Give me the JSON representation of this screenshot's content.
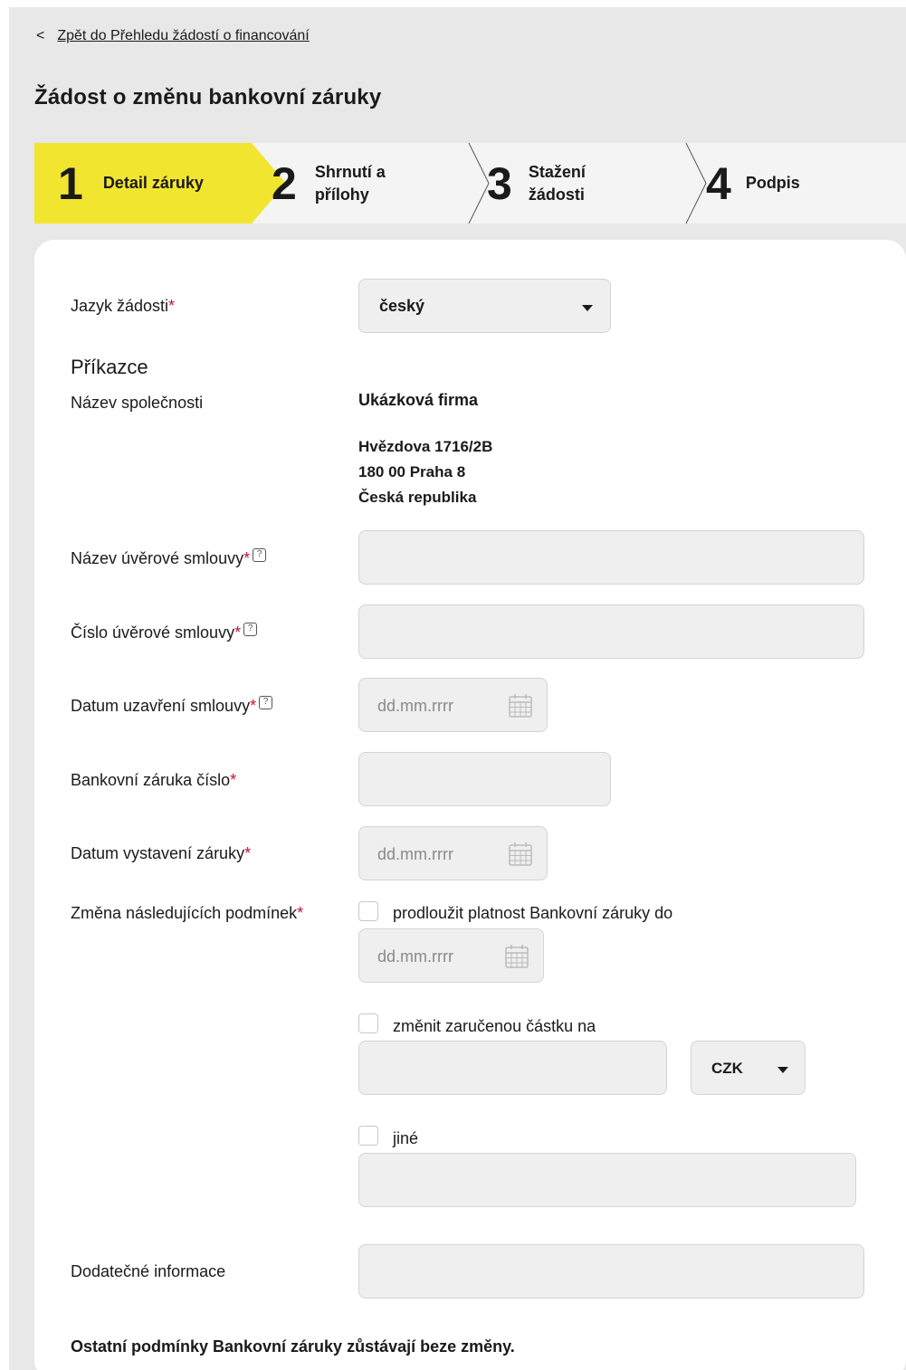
{
  "nav": {
    "back_label": "Zpět do Přehledu žádostí o financování"
  },
  "page": {
    "title": "Žádost o změnu bankovní záruky"
  },
  "stepper": {
    "steps": [
      {
        "number": "1",
        "label": "Detail záruky",
        "active": true
      },
      {
        "number": "2",
        "label": "Shrnutí a\npřílohy",
        "active": false
      },
      {
        "number": "3",
        "label": "Stažení\nžádosti",
        "active": false
      },
      {
        "number": "4",
        "label": "Podpis",
        "active": false
      }
    ],
    "active_color": "#f2e52f"
  },
  "form": {
    "language": {
      "label": "Jazyk žádosti",
      "required": "*",
      "value": "český"
    },
    "section_title": "Příkazce",
    "company": {
      "label": "Název společnosti",
      "name": "Ukázková firma",
      "address": [
        "Hvězdova  1716/2B",
        "180 00  Praha 8",
        "Česká republika"
      ]
    },
    "loan_name": {
      "label": "Název úvěrové smlouvy",
      "required": "*",
      "help": "?"
    },
    "loan_number": {
      "label": "Číslo úvěrové smlouvy",
      "required": "*",
      "help": "?"
    },
    "contract_date": {
      "label": "Datum uzavření smlouvy",
      "required": "*",
      "help": "?",
      "placeholder": "dd.mm.rrrr"
    },
    "guarantee_number": {
      "label": "Bankovní záruka číslo",
      "required": "*"
    },
    "issue_date": {
      "label": "Datum vystavení záruky",
      "required": "*",
      "placeholder": "dd.mm.rrrr"
    },
    "changes": {
      "label": "Změna následujících podmínek",
      "required": "*",
      "extend": {
        "label": "prodloužit platnost Bankovní záruky do",
        "placeholder": "dd.mm.rrrr"
      },
      "amount": {
        "label": "změnit zaručenou částku na",
        "currency": "CZK"
      },
      "other": {
        "label": "jiné"
      }
    },
    "additional_info": {
      "label": "Dodatečné informace"
    },
    "footer_note": "Ostatní podmínky Bankovní záruky zůstávají beze změny."
  }
}
